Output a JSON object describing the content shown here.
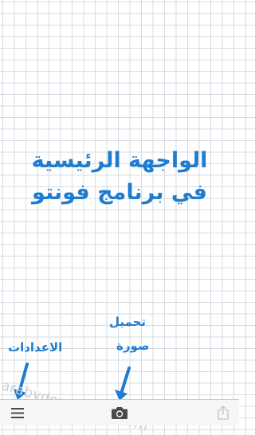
{
  "canvas": {
    "headline_line1": "الواجهة الرئيسية",
    "headline_line2": "في برنامج فونتو"
  },
  "annotations": {
    "settings_label": "الاعدادات",
    "upload_label_line1": "تحميل",
    "upload_label_line2": "صورة"
  },
  "watermark": "arabydownloads.com",
  "toolbar": {
    "menu_icon": "hamburger-menu-icon",
    "camera_icon": "camera-icon",
    "share_icon": "share-icon"
  },
  "colors": {
    "accent": "#1f7ccf",
    "grid": "#d6dce3",
    "toolbar_bg": "#f6f6f7",
    "icon": "#4a4a4a",
    "icon_disabled": "#c4c4c8"
  }
}
